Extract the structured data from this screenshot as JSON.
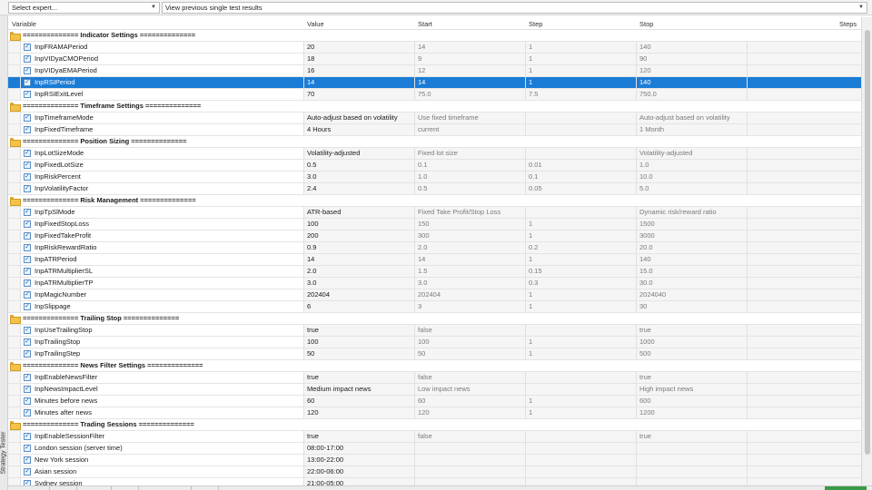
{
  "toolbar": {
    "expert_placeholder": "Select expert...",
    "results_select": "View previous single test results"
  },
  "side_tab": "Strategy Tester",
  "columns": {
    "variable": "Variable",
    "value": "Value",
    "start": "Start",
    "step": "Step",
    "stop": "Stop",
    "steps": "Steps"
  },
  "rows": [
    {
      "type": "group",
      "name": "============== Indicator Settings =============="
    },
    {
      "type": "param",
      "name": "InpFRAMAPeriod",
      "value": "20",
      "start": "14",
      "step": "1",
      "stop": "140",
      "checked": true
    },
    {
      "type": "param",
      "name": "InpVIDyaCMOPeriod",
      "value": "18",
      "start": "9",
      "step": "1",
      "stop": "90",
      "checked": true
    },
    {
      "type": "param",
      "name": "InpVIDyaEMAPeriod",
      "value": "16",
      "start": "12",
      "step": "1",
      "stop": "120",
      "checked": true
    },
    {
      "type": "param",
      "name": "InpRSIPeriod",
      "value": "14",
      "start": "14",
      "step": "1",
      "stop": "140",
      "checked": true,
      "selected": true
    },
    {
      "type": "param",
      "name": "InpRSIExitLevel",
      "value": "70",
      "start": "75.0",
      "step": "7.5",
      "stop": "750.0",
      "checked": true
    },
    {
      "type": "group",
      "name": "============== Timeframe Settings =============="
    },
    {
      "type": "param",
      "name": "InpTimeframeMode",
      "value": "Auto-adjust based on volatility",
      "start": "Use fixed timeframe",
      "step": "",
      "stop": "Auto-adjust based on volatility",
      "checked": true
    },
    {
      "type": "param",
      "name": "InpFixedTimeframe",
      "value": "4 Hours",
      "start": "current",
      "step": "",
      "stop": "1 Month",
      "checked": true
    },
    {
      "type": "group",
      "name": "============== Position Sizing =============="
    },
    {
      "type": "param",
      "name": "InpLotSizeMode",
      "value": "Volatility-adjusted",
      "start": "Fixed lot size",
      "step": "",
      "stop": "Volatility-adjusted",
      "checked": true
    },
    {
      "type": "param",
      "name": "InpFixedLotSize",
      "value": "0.5",
      "start": "0.1",
      "step": "0.01",
      "stop": "1.0",
      "checked": true
    },
    {
      "type": "param",
      "name": "InpRiskPercent",
      "value": "3.0",
      "start": "1.0",
      "step": "0.1",
      "stop": "10.0",
      "checked": true
    },
    {
      "type": "param",
      "name": "InpVolatilityFactor",
      "value": "2.4",
      "start": "0.5",
      "step": "0.05",
      "stop": "5.0",
      "checked": true
    },
    {
      "type": "group",
      "name": "============== Risk Management =============="
    },
    {
      "type": "param",
      "name": "InpTpSlMode",
      "value": "ATR-based",
      "start": "Fixed Take Profit/Stop Loss",
      "step": "",
      "stop": "Dynamic risk/reward ratio",
      "checked": true
    },
    {
      "type": "param",
      "name": "InpFixedStopLoss",
      "value": "100",
      "start": "150",
      "step": "1",
      "stop": "1500",
      "checked": true
    },
    {
      "type": "param",
      "name": "InpFixedTakeProfit",
      "value": "200",
      "start": "300",
      "step": "1",
      "stop": "3000",
      "checked": true
    },
    {
      "type": "param",
      "name": "InpRiskRewardRatio",
      "value": "0.9",
      "start": "2.0",
      "step": "0.2",
      "stop": "20.0",
      "checked": true
    },
    {
      "type": "param",
      "name": "InpATRPeriod",
      "value": "14",
      "start": "14",
      "step": "1",
      "stop": "140",
      "checked": true
    },
    {
      "type": "param",
      "name": "InpATRMultiplierSL",
      "value": "2.0",
      "start": "1.5",
      "step": "0.15",
      "stop": "15.0",
      "checked": true
    },
    {
      "type": "param",
      "name": "InpATRMultiplierTP",
      "value": "3.0",
      "start": "3.0",
      "step": "0.3",
      "stop": "30.0",
      "checked": true
    },
    {
      "type": "param",
      "name": "InpMagicNumber",
      "value": "202404",
      "start": "202404",
      "step": "1",
      "stop": "2024040",
      "checked": true
    },
    {
      "type": "param",
      "name": "InpSlippage",
      "value": "6",
      "start": "3",
      "step": "1",
      "stop": "30",
      "checked": true
    },
    {
      "type": "group",
      "name": "============== Trailing Stop =============="
    },
    {
      "type": "param",
      "name": "InpUseTrailingStop",
      "value": "true",
      "start": "false",
      "step": "",
      "stop": "true",
      "checked": true
    },
    {
      "type": "param",
      "name": "InpTrailingStop",
      "value": "100",
      "start": "100",
      "step": "1",
      "stop": "1000",
      "checked": true
    },
    {
      "type": "param",
      "name": "InpTrailingStep",
      "value": "50",
      "start": "50",
      "step": "1",
      "stop": "500",
      "checked": true
    },
    {
      "type": "group",
      "name": "============== News Filter Settings =============="
    },
    {
      "type": "param",
      "name": "InpEnableNewsFilter",
      "value": "true",
      "start": "false",
      "step": "",
      "stop": "true",
      "checked": true
    },
    {
      "type": "param",
      "name": "InpNewsImpactLevel",
      "value": "Medium impact news",
      "start": "Low impact news",
      "step": "",
      "stop": "High impact news",
      "checked": true
    },
    {
      "type": "param",
      "name": "Minutes before news",
      "value": "60",
      "start": "60",
      "step": "1",
      "stop": "600",
      "checked": true
    },
    {
      "type": "param",
      "name": "Minutes after news",
      "value": "120",
      "start": "120",
      "step": "1",
      "stop": "1200",
      "checked": true
    },
    {
      "type": "group",
      "name": "============== Trading Sessions =============="
    },
    {
      "type": "param",
      "name": "InpEnableSessionFilter",
      "value": "true",
      "start": "false",
      "step": "",
      "stop": "true",
      "checked": true
    },
    {
      "type": "param",
      "name": "London session (server time)",
      "value": "08:00-17:00",
      "start": "",
      "step": "",
      "stop": "",
      "checked": true
    },
    {
      "type": "param",
      "name": "New York session",
      "value": "13:00-22:00",
      "start": "",
      "step": "",
      "stop": "",
      "checked": true
    },
    {
      "type": "param",
      "name": "Asian session",
      "value": "22:00-06:00",
      "start": "",
      "step": "",
      "stop": "",
      "checked": true
    },
    {
      "type": "param",
      "name": "Sydney session",
      "value": "21:00-05:00",
      "start": "",
      "step": "",
      "stop": "",
      "checked": true
    }
  ]
}
